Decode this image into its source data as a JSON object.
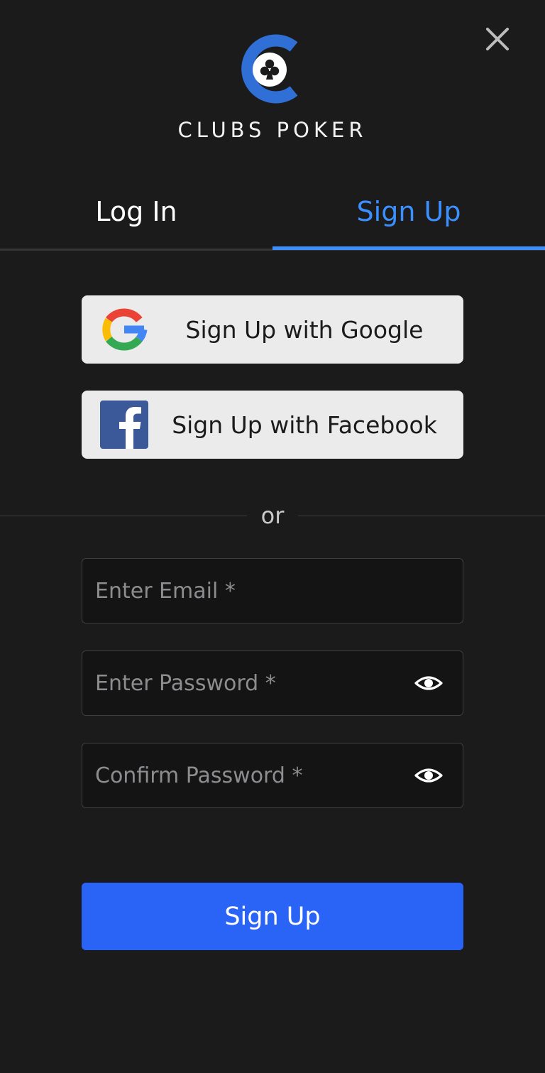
{
  "brand": {
    "name": "CLUBS POKER",
    "accent_color": "#3b8fff",
    "logo_icon": "clubs-poker-logo-icon"
  },
  "close": {
    "icon": "close-icon"
  },
  "tabs": [
    {
      "label": "Log In",
      "active": false
    },
    {
      "label": "Sign Up",
      "active": true
    }
  ],
  "social": {
    "google_label": "Sign Up with Google",
    "google_icon": "google-icon",
    "facebook_label": "Sign Up with Facebook",
    "facebook_icon": "facebook-icon"
  },
  "divider": {
    "text": "or"
  },
  "form": {
    "email_placeholder": "Enter Email *",
    "email_value": "",
    "password_placeholder": "Enter Password *",
    "password_value": "",
    "confirm_placeholder": "Confirm Password *",
    "confirm_value": "",
    "toggle_icon": "eye-icon"
  },
  "submit": {
    "label": "Sign Up",
    "color": "#2a64f6"
  }
}
